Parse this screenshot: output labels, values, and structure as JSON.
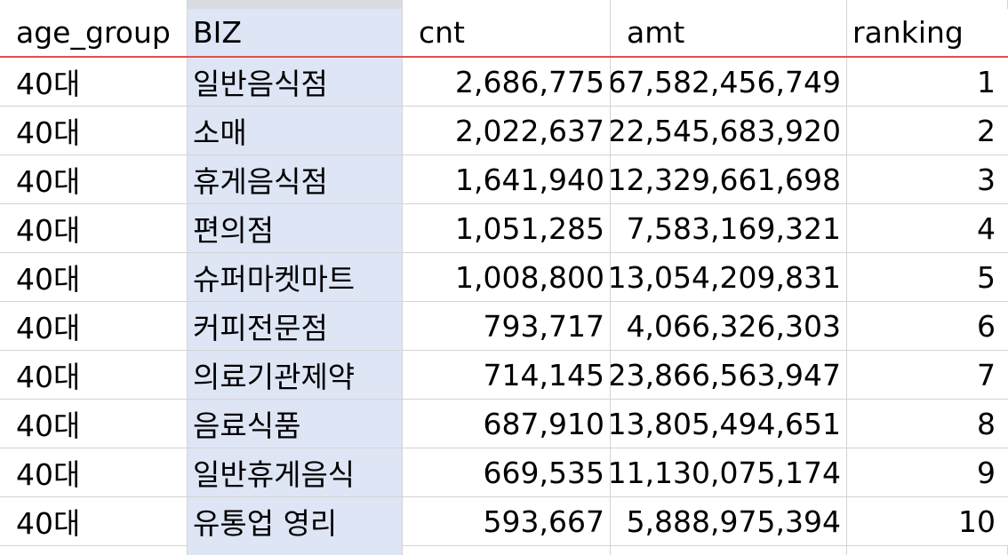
{
  "columns": [
    "age_group",
    "BIZ",
    "cnt",
    "amt",
    "ranking"
  ],
  "rows": [
    {
      "age_group": "40대",
      "BIZ": "일반음식점",
      "cnt": "2,686,775",
      "amt": "67,582,456,749",
      "ranking": "1"
    },
    {
      "age_group": "40대",
      "BIZ": "소매",
      "cnt": "2,022,637",
      "amt": "22,545,683,920",
      "ranking": "2"
    },
    {
      "age_group": "40대",
      "BIZ": "휴게음식점",
      "cnt": "1,641,940",
      "amt": "12,329,661,698",
      "ranking": "3"
    },
    {
      "age_group": "40대",
      "BIZ": "편의점",
      "cnt": "1,051,285",
      "amt": "7,583,169,321",
      "ranking": "4"
    },
    {
      "age_group": "40대",
      "BIZ": "슈퍼마켓마트",
      "cnt": "1,008,800",
      "amt": "13,054,209,831",
      "ranking": "5"
    },
    {
      "age_group": "40대",
      "BIZ": "커피전문점",
      "cnt": "793,717",
      "amt": "4,066,326,303",
      "ranking": "6"
    },
    {
      "age_group": "40대",
      "BIZ": "의료기관제약",
      "cnt": "714,145",
      "amt": "23,866,563,947",
      "ranking": "7"
    },
    {
      "age_group": "40대",
      "BIZ": "음료식품",
      "cnt": "687,910",
      "amt": "13,805,494,651",
      "ranking": "8"
    },
    {
      "age_group": "40대",
      "BIZ": "일반휴게음식",
      "cnt": "669,535",
      "amt": "11,130,075,174",
      "ranking": "9"
    },
    {
      "age_group": "40대",
      "BIZ": "유통업 영리",
      "cnt": "593,667",
      "amt": "5,888,975,394",
      "ranking": "10"
    }
  ],
  "colors": {
    "selected_column_fill": "#dee5f5",
    "header_divider": "#e05050",
    "gridline": "#d4d4d4"
  }
}
